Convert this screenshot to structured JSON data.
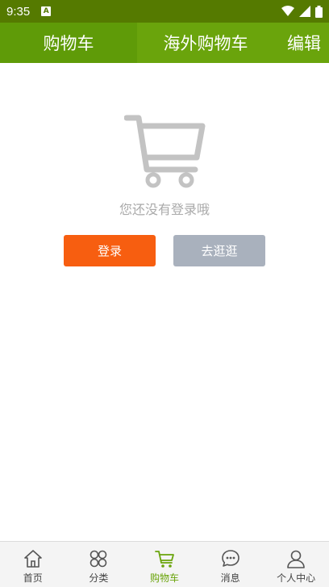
{
  "status_bar": {
    "time": "9:35",
    "badge": "A"
  },
  "header": {
    "tabs": [
      {
        "label": "购物车",
        "active": true
      },
      {
        "label": "海外购物车",
        "active": false
      }
    ],
    "edit_label": "编辑"
  },
  "empty_state": {
    "message": "您还没有登录哦",
    "login_label": "登录",
    "browse_label": "去逛逛"
  },
  "bottom_nav": {
    "items": [
      {
        "label": "首页",
        "icon": "home-icon"
      },
      {
        "label": "分类",
        "icon": "category-icon"
      },
      {
        "label": "购物车",
        "icon": "cart-icon",
        "active": true
      },
      {
        "label": "消息",
        "icon": "message-icon"
      },
      {
        "label": "个人中心",
        "icon": "user-icon"
      }
    ]
  },
  "colors": {
    "status_bar": "#557a00",
    "header": "#6aa40c",
    "active_tab": "#5f9b08",
    "login_button": "#f75e10",
    "browse_button": "#a9b1bd",
    "nav_active": "#6aa40c"
  }
}
